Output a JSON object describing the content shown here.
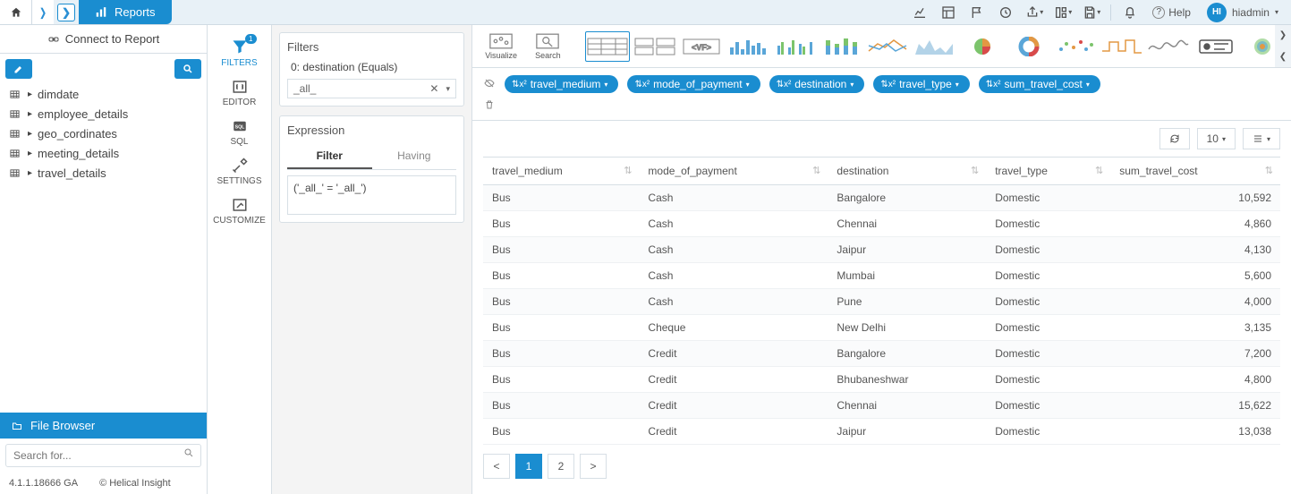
{
  "breadcrumb": {
    "reports": "Reports"
  },
  "topbar": {
    "help": "Help",
    "user_initials": "HI",
    "user_name": "hiadmin"
  },
  "sidebar": {
    "connect": "Connect to Report",
    "tables": [
      "dimdate",
      "employee_details",
      "geo_cordinates",
      "meeting_details",
      "travel_details"
    ],
    "file_browser": "File Browser",
    "search_placeholder": "Search for...",
    "version": "4.1.1.18666 GA",
    "copyright": "© Helical Insight"
  },
  "toolcol": {
    "filters": "FILTERS",
    "filter_count": "1",
    "editor": "EDITOR",
    "sql": "SQL",
    "settings": "SETTINGS",
    "customize": "CUSTOMIZE"
  },
  "chartbar": {
    "visualize": "Visualize",
    "search": "Search"
  },
  "filter_panel": {
    "filters_title": "Filters",
    "filter0": "0: destination (Equals)",
    "filter0_val": "_all_",
    "expression_title": "Expression",
    "tab_filter": "Filter",
    "tab_having": "Having",
    "expression_val": "('_all_' = '_all_')"
  },
  "pills": [
    "travel_medium",
    "mode_of_payment",
    "destination",
    "travel_type",
    "sum_travel_cost"
  ],
  "table": {
    "headers": [
      "travel_medium",
      "mode_of_payment",
      "destination",
      "travel_type",
      "sum_travel_cost"
    ],
    "rows": [
      [
        "Bus",
        "Cash",
        "Bangalore",
        "Domestic",
        "10,592"
      ],
      [
        "Bus",
        "Cash",
        "Chennai",
        "Domestic",
        "4,860"
      ],
      [
        "Bus",
        "Cash",
        "Jaipur",
        "Domestic",
        "4,130"
      ],
      [
        "Bus",
        "Cash",
        "Mumbai",
        "Domestic",
        "5,600"
      ],
      [
        "Bus",
        "Cash",
        "Pune",
        "Domestic",
        "4,000"
      ],
      [
        "Bus",
        "Cheque",
        "New Delhi",
        "Domestic",
        "3,135"
      ],
      [
        "Bus",
        "Credit",
        "Bangalore",
        "Domestic",
        "7,200"
      ],
      [
        "Bus",
        "Credit",
        "Bhubaneshwar",
        "Domestic",
        "4,800"
      ],
      [
        "Bus",
        "Credit",
        "Chennai",
        "Domestic",
        "15,622"
      ],
      [
        "Bus",
        "Credit",
        "Jaipur",
        "Domestic",
        "13,038"
      ]
    ],
    "page_size": "10",
    "pages": [
      "1",
      "2"
    ]
  }
}
